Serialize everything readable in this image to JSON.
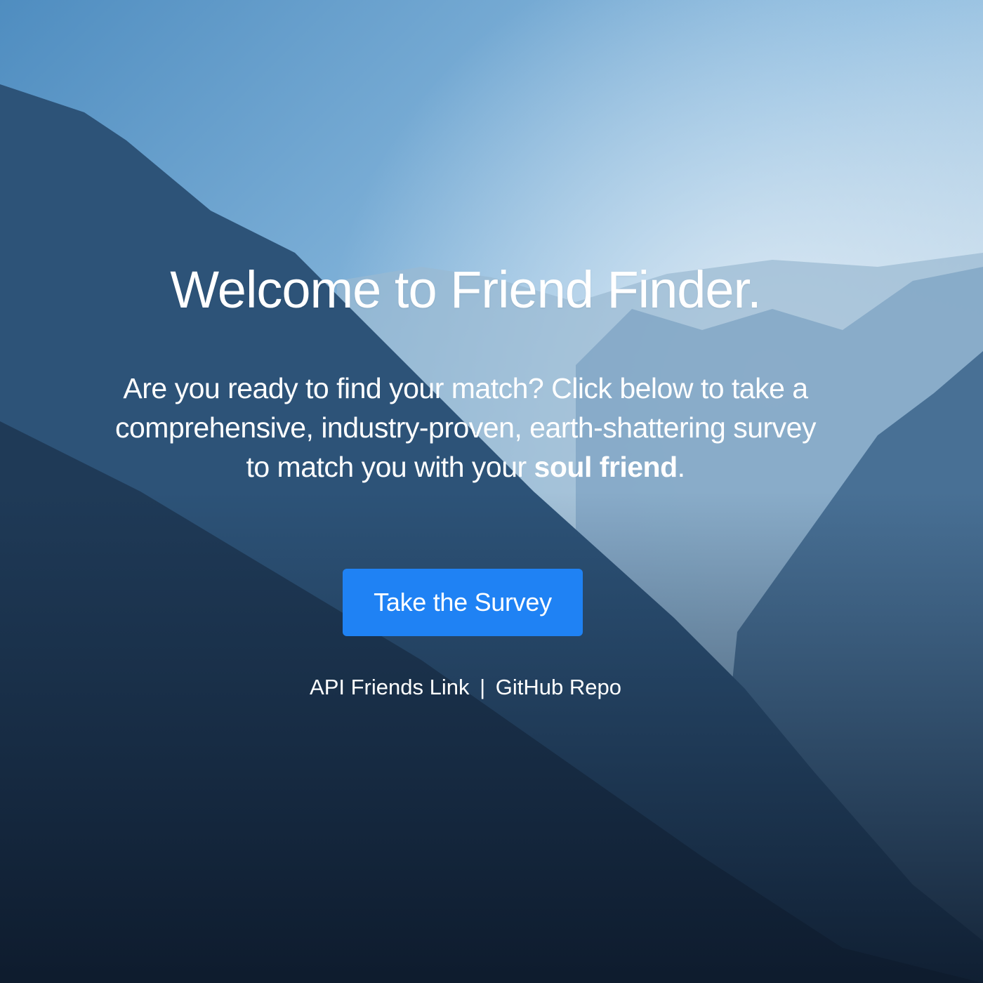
{
  "page": {
    "title": "Welcome to Friend Finder.",
    "lead_text": "Are you ready to find your match? Click below to take a comprehensive, industry-proven, earth-shattering survey to match you with your ",
    "lead_emphasis": "soul friend",
    "lead_end": "."
  },
  "actions": {
    "survey_button_label": "Take the Survey"
  },
  "footer_links": {
    "api_link_label": "API Friends Link",
    "separator": "|",
    "github_link_label": "GitHub Repo"
  },
  "colors": {
    "button": "#1f82f4",
    "text": "#ffffff",
    "sky_top": "#8ec1e6",
    "mountain_dark": "#12263f"
  }
}
